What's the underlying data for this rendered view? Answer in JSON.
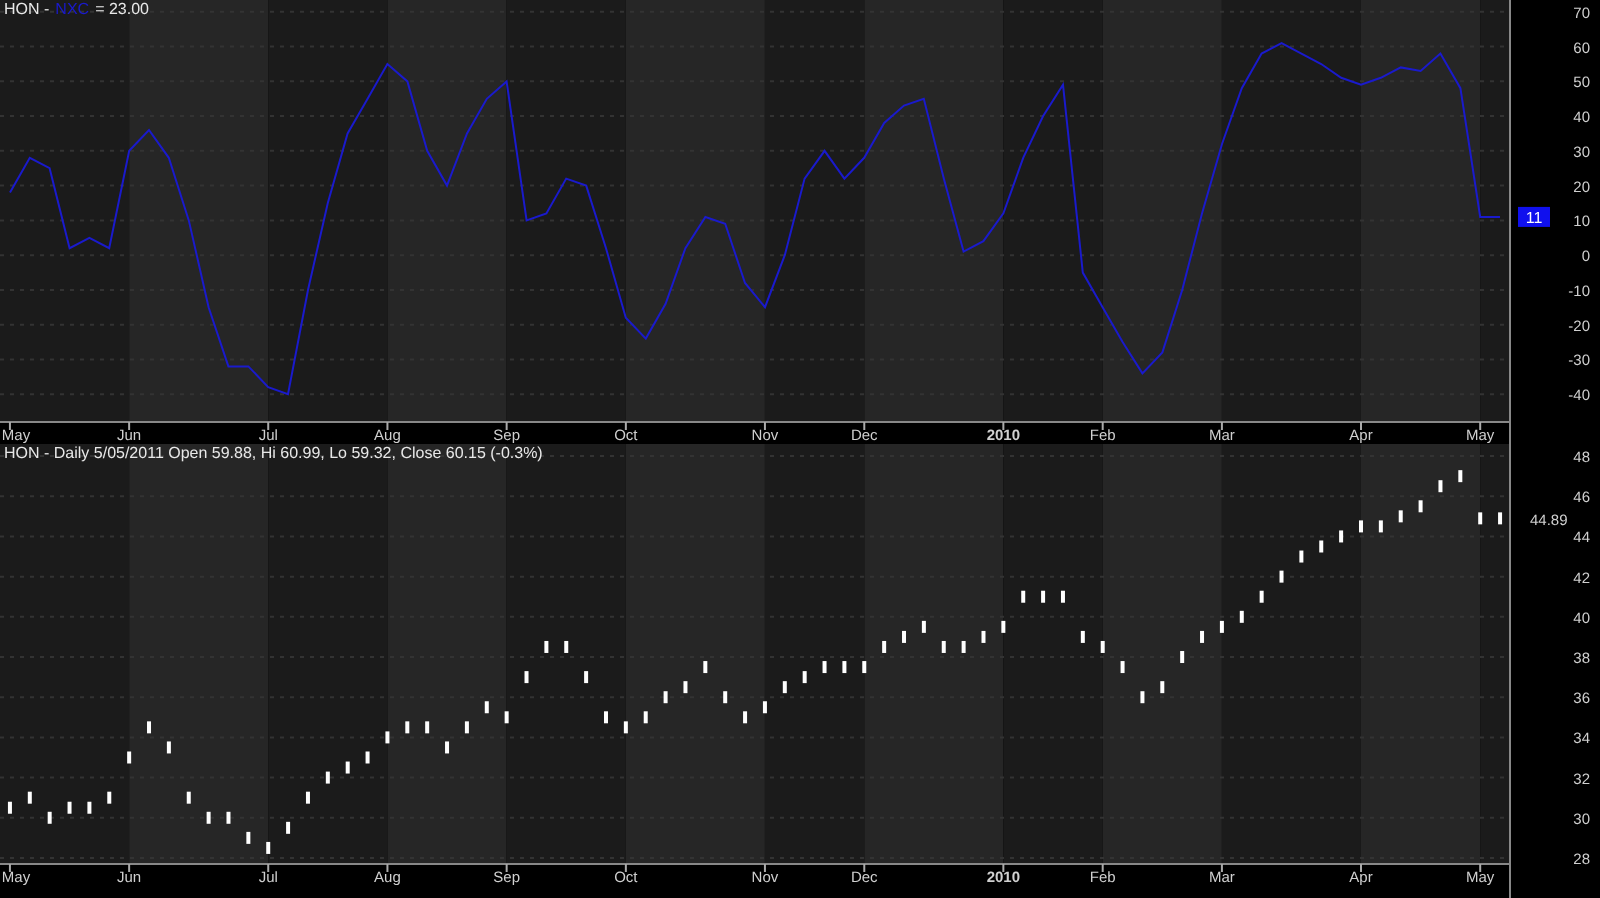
{
  "panels": [
    {
      "header": [
        {
          "text": "HON -",
          "kind": "plain"
        },
        {
          "kind": "series"
        },
        {
          "text": "= 23.00",
          "kind": "plain"
        }
      ],
      "last_value": "11",
      "chart_data": {
        "type": "line",
        "grid": true,
        "ylim": [
          -48,
          73.4
        ],
        "yticks": [
          -40,
          -30,
          -20,
          -10,
          0,
          10,
          20,
          30,
          40,
          50,
          60,
          70
        ],
        "categories": [
          "May",
          null,
          null,
          null,
          null,
          null,
          "Jun",
          null,
          null,
          null,
          null,
          null,
          null,
          "Jul",
          null,
          null,
          null,
          null,
          null,
          "Aug",
          null,
          null,
          null,
          null,
          null,
          "Sep",
          null,
          null,
          null,
          null,
          null,
          "Oct",
          null,
          null,
          null,
          null,
          null,
          null,
          "Nov",
          null,
          null,
          null,
          null,
          "Dec",
          null,
          null,
          null,
          null,
          null,
          null,
          "2010",
          null,
          null,
          null,
          null,
          "Feb",
          null,
          null,
          null,
          null,
          null,
          "Mar",
          null,
          null,
          null,
          null,
          null,
          null,
          "Apr",
          null,
          null,
          null,
          null,
          null,
          "May",
          null
        ],
        "series": [
          {
            "name": "NXC",
            "color": "#1a1acc",
            "values": [
              18,
              28,
              25,
              2,
              5,
              2,
              30,
              36,
              28,
              10,
              -15,
              -32,
              -32,
              -38,
              -40,
              -10,
              15,
              35,
              45,
              55,
              50,
              30,
              20,
              35,
              45,
              50,
              10,
              12,
              22,
              20,
              2,
              -18,
              -24,
              -14,
              2,
              11,
              9,
              -8,
              -15,
              0,
              22,
              30,
              22,
              28,
              38,
              43,
              45,
              22,
              1,
              4,
              12,
              28,
              40,
              49,
              -5,
              -15,
              -25,
              -34,
              -28,
              -10,
              12,
              32,
              48,
              58,
              61,
              58,
              55,
              51,
              49,
              51,
              54,
              53,
              58,
              48,
              11,
              11
            ]
          }
        ]
      }
    },
    {
      "header": [
        {
          "text": "HON - Daily 5/05/2011 Open 59.88, Hi 60.99, Lo 59.32, Close 60.15 (-0.3%)",
          "kind": "plain"
        }
      ],
      "last_value": "44.89",
      "chart_data": {
        "type": "scatter",
        "grid": true,
        "ylim": [
          27.7,
          48.6
        ],
        "yticks": [
          28,
          30,
          32,
          34,
          36,
          38,
          40,
          42,
          44,
          46,
          48
        ],
        "categories": [
          "May",
          null,
          null,
          null,
          null,
          null,
          "Jun",
          null,
          null,
          null,
          null,
          null,
          null,
          "Jul",
          null,
          null,
          null,
          null,
          null,
          "Aug",
          null,
          null,
          null,
          null,
          null,
          "Sep",
          null,
          null,
          null,
          null,
          null,
          "Oct",
          null,
          null,
          null,
          null,
          null,
          null,
          "Nov",
          null,
          null,
          null,
          null,
          "Dec",
          null,
          null,
          null,
          null,
          null,
          null,
          "2010",
          null,
          null,
          null,
          null,
          "Feb",
          null,
          null,
          null,
          null,
          null,
          "Mar",
          null,
          null,
          null,
          null,
          null,
          null,
          "Apr",
          null,
          null,
          null,
          null,
          null,
          "May",
          null
        ],
        "series": [
          {
            "color": "#ffffff",
            "values": [
              30.5,
              31,
              30,
              30.5,
              30.5,
              31,
              33,
              34.5,
              33.5,
              31,
              30,
              30,
              29,
              28.5,
              29.5,
              31,
              32,
              32.5,
              33,
              34,
              34.5,
              34.5,
              33.5,
              34.5,
              35.5,
              35,
              37,
              38.5,
              38.5,
              37,
              35,
              34.5,
              35,
              36,
              36.5,
              37.5,
              36,
              35,
              35.5,
              36.5,
              37,
              37.5,
              37.5,
              37.5,
              38.5,
              39,
              39.5,
              38.5,
              38.5,
              39,
              39.5,
              41,
              41,
              41,
              39,
              38.5,
              37.5,
              36,
              36.5,
              38,
              39,
              39.5,
              40,
              41,
              42,
              43,
              43.5,
              44,
              44.5,
              44.5,
              45,
              45.5,
              46.5,
              47,
              44.9,
              44.9
            ]
          }
        ]
      }
    }
  ]
}
